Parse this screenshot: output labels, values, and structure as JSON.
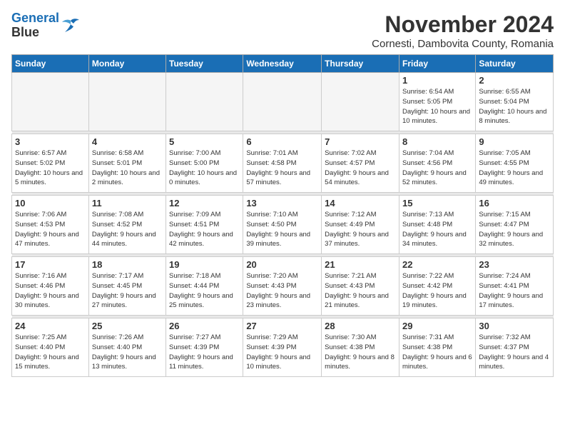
{
  "header": {
    "logo_line1": "General",
    "logo_line2": "Blue",
    "month": "November 2024",
    "location": "Cornesti, Dambovita County, Romania"
  },
  "weekdays": [
    "Sunday",
    "Monday",
    "Tuesday",
    "Wednesday",
    "Thursday",
    "Friday",
    "Saturday"
  ],
  "weeks": [
    [
      {
        "day": "",
        "info": ""
      },
      {
        "day": "",
        "info": ""
      },
      {
        "day": "",
        "info": ""
      },
      {
        "day": "",
        "info": ""
      },
      {
        "day": "",
        "info": ""
      },
      {
        "day": "1",
        "info": "Sunrise: 6:54 AM\nSunset: 5:05 PM\nDaylight: 10 hours and 10 minutes."
      },
      {
        "day": "2",
        "info": "Sunrise: 6:55 AM\nSunset: 5:04 PM\nDaylight: 10 hours and 8 minutes."
      }
    ],
    [
      {
        "day": "3",
        "info": "Sunrise: 6:57 AM\nSunset: 5:02 PM\nDaylight: 10 hours and 5 minutes."
      },
      {
        "day": "4",
        "info": "Sunrise: 6:58 AM\nSunset: 5:01 PM\nDaylight: 10 hours and 2 minutes."
      },
      {
        "day": "5",
        "info": "Sunrise: 7:00 AM\nSunset: 5:00 PM\nDaylight: 10 hours and 0 minutes."
      },
      {
        "day": "6",
        "info": "Sunrise: 7:01 AM\nSunset: 4:58 PM\nDaylight: 9 hours and 57 minutes."
      },
      {
        "day": "7",
        "info": "Sunrise: 7:02 AM\nSunset: 4:57 PM\nDaylight: 9 hours and 54 minutes."
      },
      {
        "day": "8",
        "info": "Sunrise: 7:04 AM\nSunset: 4:56 PM\nDaylight: 9 hours and 52 minutes."
      },
      {
        "day": "9",
        "info": "Sunrise: 7:05 AM\nSunset: 4:55 PM\nDaylight: 9 hours and 49 minutes."
      }
    ],
    [
      {
        "day": "10",
        "info": "Sunrise: 7:06 AM\nSunset: 4:53 PM\nDaylight: 9 hours and 47 minutes."
      },
      {
        "day": "11",
        "info": "Sunrise: 7:08 AM\nSunset: 4:52 PM\nDaylight: 9 hours and 44 minutes."
      },
      {
        "day": "12",
        "info": "Sunrise: 7:09 AM\nSunset: 4:51 PM\nDaylight: 9 hours and 42 minutes."
      },
      {
        "day": "13",
        "info": "Sunrise: 7:10 AM\nSunset: 4:50 PM\nDaylight: 9 hours and 39 minutes."
      },
      {
        "day": "14",
        "info": "Sunrise: 7:12 AM\nSunset: 4:49 PM\nDaylight: 9 hours and 37 minutes."
      },
      {
        "day": "15",
        "info": "Sunrise: 7:13 AM\nSunset: 4:48 PM\nDaylight: 9 hours and 34 minutes."
      },
      {
        "day": "16",
        "info": "Sunrise: 7:15 AM\nSunset: 4:47 PM\nDaylight: 9 hours and 32 minutes."
      }
    ],
    [
      {
        "day": "17",
        "info": "Sunrise: 7:16 AM\nSunset: 4:46 PM\nDaylight: 9 hours and 30 minutes."
      },
      {
        "day": "18",
        "info": "Sunrise: 7:17 AM\nSunset: 4:45 PM\nDaylight: 9 hours and 27 minutes."
      },
      {
        "day": "19",
        "info": "Sunrise: 7:18 AM\nSunset: 4:44 PM\nDaylight: 9 hours and 25 minutes."
      },
      {
        "day": "20",
        "info": "Sunrise: 7:20 AM\nSunset: 4:43 PM\nDaylight: 9 hours and 23 minutes."
      },
      {
        "day": "21",
        "info": "Sunrise: 7:21 AM\nSunset: 4:43 PM\nDaylight: 9 hours and 21 minutes."
      },
      {
        "day": "22",
        "info": "Sunrise: 7:22 AM\nSunset: 4:42 PM\nDaylight: 9 hours and 19 minutes."
      },
      {
        "day": "23",
        "info": "Sunrise: 7:24 AM\nSunset: 4:41 PM\nDaylight: 9 hours and 17 minutes."
      }
    ],
    [
      {
        "day": "24",
        "info": "Sunrise: 7:25 AM\nSunset: 4:40 PM\nDaylight: 9 hours and 15 minutes."
      },
      {
        "day": "25",
        "info": "Sunrise: 7:26 AM\nSunset: 4:40 PM\nDaylight: 9 hours and 13 minutes."
      },
      {
        "day": "26",
        "info": "Sunrise: 7:27 AM\nSunset: 4:39 PM\nDaylight: 9 hours and 11 minutes."
      },
      {
        "day": "27",
        "info": "Sunrise: 7:29 AM\nSunset: 4:39 PM\nDaylight: 9 hours and 10 minutes."
      },
      {
        "day": "28",
        "info": "Sunrise: 7:30 AM\nSunset: 4:38 PM\nDaylight: 9 hours and 8 minutes."
      },
      {
        "day": "29",
        "info": "Sunrise: 7:31 AM\nSunset: 4:38 PM\nDaylight: 9 hours and 6 minutes."
      },
      {
        "day": "30",
        "info": "Sunrise: 7:32 AM\nSunset: 4:37 PM\nDaylight: 9 hours and 4 minutes."
      }
    ]
  ]
}
